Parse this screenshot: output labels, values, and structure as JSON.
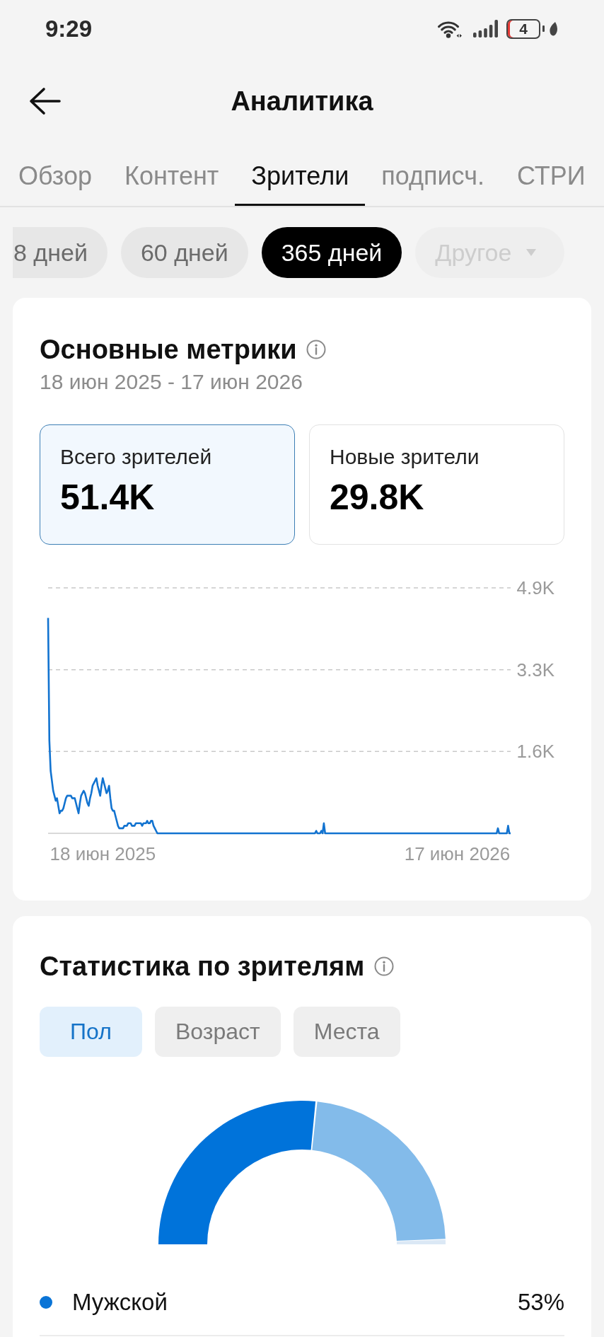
{
  "status_bar": {
    "time": "9:29",
    "battery": "4"
  },
  "header": {
    "title": "Аналитика"
  },
  "tabs": [
    {
      "label": "Обзор",
      "selected": false
    },
    {
      "label": "Контент",
      "selected": false
    },
    {
      "label": "Зрители",
      "selected": true
    },
    {
      "label": "подписч.",
      "selected": false
    },
    {
      "label": "СТРИ",
      "selected": false
    }
  ],
  "periods": [
    {
      "label": "8 дней",
      "kind": "preset",
      "selected": false,
      "disabled": false
    },
    {
      "label": "60 дней",
      "kind": "preset",
      "selected": false,
      "disabled": false
    },
    {
      "label": "365 дней",
      "kind": "preset",
      "selected": true,
      "disabled": false
    },
    {
      "label": "Другое",
      "kind": "dropdown",
      "selected": false,
      "disabled": true
    }
  ],
  "key_metrics": {
    "title": "Основные метрики",
    "date_range": "18 июн 2025 - 17 июн 2026",
    "tiles": [
      {
        "label": "Всего зрителей",
        "value": "51.4K",
        "selected": true
      },
      {
        "label": "Новые зрители",
        "value": "29.8K",
        "selected": false
      }
    ],
    "chart_data": {
      "type": "line",
      "categories": [
        null,
        null,
        null,
        null,
        null,
        null,
        null,
        null,
        null,
        null,
        null,
        null,
        null,
        null,
        null,
        null,
        null,
        null,
        null,
        null,
        null,
        null,
        null,
        null,
        null,
        null,
        null,
        null,
        null,
        null,
        null,
        null,
        null,
        null,
        null,
        null,
        null,
        null,
        null,
        null,
        null,
        null,
        null,
        "18 июн 2025",
        null,
        null,
        null,
        null,
        null,
        null,
        null,
        null,
        null,
        null,
        null,
        null,
        null,
        null,
        null,
        null,
        null,
        null,
        null,
        null,
        null,
        null,
        null,
        null,
        null,
        null,
        null,
        null,
        null,
        null,
        null,
        null,
        null,
        null,
        null,
        null,
        null,
        null,
        null,
        null,
        null,
        null,
        null,
        null,
        null,
        null,
        null,
        null,
        null,
        null,
        null,
        null,
        null,
        null,
        null,
        null,
        null,
        null,
        null,
        null,
        null,
        null,
        null,
        null,
        null,
        null,
        null,
        null,
        null,
        null,
        null,
        null,
        null,
        null,
        null,
        null,
        null,
        null,
        null,
        null,
        null,
        null,
        null,
        null,
        null,
        null,
        null,
        null,
        null,
        null,
        null,
        null,
        null,
        null,
        null,
        null,
        null,
        null,
        null,
        null,
        null,
        null,
        null,
        null,
        null,
        null,
        null,
        null,
        null,
        null,
        null,
        null,
        null,
        null,
        null,
        null,
        null,
        null,
        null,
        null,
        null,
        null,
        null,
        null,
        null,
        null,
        null,
        null,
        null,
        null,
        null,
        null,
        null,
        null,
        null,
        null,
        null,
        null,
        null,
        null,
        null,
        null,
        null,
        null,
        null,
        null,
        null,
        null,
        null,
        null,
        null,
        null,
        null,
        null,
        null,
        null,
        null,
        null,
        null,
        null,
        null,
        null,
        null,
        null,
        null,
        null,
        null,
        null,
        null,
        null,
        null,
        null,
        null,
        null,
        null,
        null,
        null,
        null,
        null,
        null,
        null,
        null,
        null,
        null,
        null,
        null,
        null,
        null,
        null,
        null,
        null,
        null,
        null,
        null,
        null,
        null,
        null,
        null,
        null,
        null,
        null,
        null,
        null,
        null,
        null,
        null,
        null,
        null,
        null,
        null,
        null,
        null,
        null,
        null,
        null,
        null,
        null,
        null,
        null,
        null,
        null,
        null,
        null,
        null,
        null,
        null,
        null,
        null,
        null,
        null,
        null,
        null,
        null,
        null,
        null,
        null,
        null,
        null,
        null,
        null,
        null,
        null,
        null,
        null,
        null,
        null,
        null,
        null,
        null,
        null,
        null,
        null,
        null,
        null,
        null,
        null,
        null,
        null,
        null,
        null,
        null,
        null,
        null,
        null,
        null,
        null,
        null,
        null,
        null,
        null,
        null,
        null,
        null,
        null,
        null,
        null,
        null,
        null,
        "17 июн 2026",
        null,
        null,
        null,
        null,
        null,
        null,
        null,
        null,
        null,
        null,
        null,
        null,
        null,
        null,
        null,
        null,
        null,
        null,
        null,
        null,
        null,
        null,
        null,
        null,
        null,
        null,
        null,
        null,
        null,
        null,
        null,
        null,
        null,
        null,
        null,
        null,
        null,
        null,
        null,
        null,
        null,
        null
      ],
      "series": [
        {
          "color": "#1273d0",
          "values": [
            4300,
            1850,
            1250,
            1050,
            850,
            750,
            650,
            700,
            550,
            400,
            450,
            450,
            500,
            600,
            700,
            750,
            750,
            750,
            750,
            700,
            700,
            700,
            600,
            500,
            400,
            600,
            750,
            800,
            850,
            800,
            700,
            600,
            550,
            700,
            800,
            950,
            1000,
            1050,
            1100,
            950,
            850,
            750,
            950,
            1100,
            1000,
            900,
            800,
            850,
            950,
            700,
            500,
            450,
            450,
            350,
            250,
            150,
            100,
            100,
            100,
            100,
            150,
            150,
            150,
            200,
            200,
            200,
            150,
            150,
            150,
            200,
            200,
            200,
            200,
            200,
            150,
            200,
            200,
            200,
            250,
            200,
            200,
            250,
            250,
            150,
            100,
            50,
            0,
            0,
            0,
            0,
            0,
            0,
            0,
            0,
            0,
            0,
            0,
            0,
            0,
            0,
            0,
            0,
            0,
            0,
            0,
            0,
            0,
            0,
            0,
            0,
            0,
            0,
            0,
            0,
            0,
            0,
            0,
            0,
            0,
            0,
            0,
            0,
            0,
            0,
            0,
            0,
            0,
            0,
            0,
            0,
            0,
            0,
            0,
            0,
            0,
            0,
            0,
            0,
            0,
            0,
            0,
            0,
            0,
            0,
            0,
            0,
            0,
            0,
            0,
            0,
            0,
            0,
            0,
            0,
            0,
            0,
            0,
            0,
            0,
            0,
            0,
            0,
            0,
            0,
            0,
            0,
            0,
            0,
            0,
            0,
            0,
            0,
            0,
            0,
            0,
            0,
            0,
            0,
            0,
            0,
            0,
            0,
            0,
            0,
            0,
            0,
            0,
            0,
            0,
            0,
            0,
            0,
            0,
            0,
            0,
            0,
            0,
            0,
            0,
            0,
            0,
            0,
            0,
            0,
            0,
            0,
            0,
            0,
            0,
            0,
            0,
            50,
            0,
            0,
            0,
            50,
            0,
            200,
            0,
            0,
            0,
            0,
            0,
            0,
            0,
            0,
            0,
            0,
            0,
            0,
            0,
            0,
            0,
            0,
            0,
            0,
            0,
            0,
            0,
            0,
            0,
            0,
            0,
            0,
            0,
            0,
            0,
            0,
            0,
            0,
            0,
            0,
            0,
            0,
            0,
            0,
            0,
            0,
            0,
            0,
            0,
            0,
            0,
            0,
            0,
            0,
            0,
            0,
            0,
            0,
            0,
            0,
            0,
            0,
            0,
            0,
            0,
            0,
            0,
            0,
            0,
            0,
            0,
            0,
            0,
            0,
            0,
            0,
            0,
            0,
            0,
            0,
            0,
            0,
            0,
            0,
            0,
            0,
            0,
            0,
            0,
            0,
            0,
            0,
            0,
            0,
            0,
            0,
            0,
            0,
            0,
            0,
            0,
            0,
            0,
            0,
            0,
            0,
            0,
            0,
            0,
            0,
            0,
            0,
            0,
            0,
            0,
            0,
            0,
            0,
            0,
            0,
            0,
            0,
            0,
            0,
            0,
            0,
            0,
            0,
            0,
            0,
            0,
            0,
            0,
            0,
            0,
            0,
            0,
            0,
            0,
            0,
            0,
            0,
            100,
            0,
            0,
            0,
            0,
            0,
            0,
            0,
            150,
            0,
            0
          ]
        }
      ],
      "ylim": [
        0,
        4900
      ],
      "yticks": [
        {
          "value": 1633,
          "label": "1.6K"
        },
        {
          "value": 3267,
          "label": "3.3K"
        },
        {
          "value": 4900,
          "label": "4.9K"
        }
      ]
    }
  },
  "audience": {
    "title": "Статистика по зрителям",
    "segments": [
      {
        "label": "Пол",
        "selected": true
      },
      {
        "label": "Возраст",
        "selected": false
      },
      {
        "label": "Места",
        "selected": false
      }
    ],
    "legend": [
      {
        "label": "Мужской",
        "value": "53%",
        "color": "#0a74d6"
      }
    ]
  }
}
